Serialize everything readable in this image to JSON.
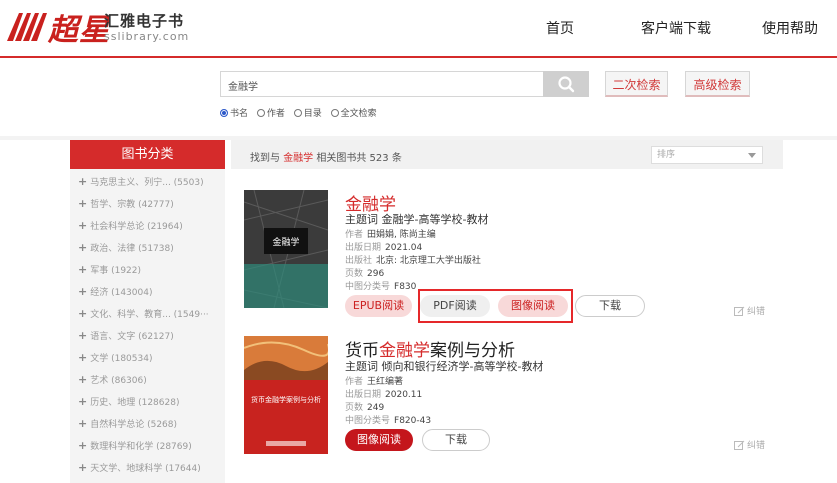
{
  "header": {
    "logo_cn": "超星",
    "title": "汇雅电子书",
    "subtitle": "sslibrary.com",
    "nav": [
      "首页",
      "客户端下载",
      "使用帮助"
    ]
  },
  "search": {
    "query": "金融学",
    "buttons": {
      "secondary": "二次检索",
      "advanced": "高级检索"
    },
    "scopes": [
      {
        "label": "书名",
        "selected": true
      },
      {
        "label": "作者",
        "selected": false
      },
      {
        "label": "目录",
        "selected": false
      },
      {
        "label": "全文检索",
        "selected": false
      }
    ]
  },
  "sidebar": {
    "heading": "图书分类",
    "categories": [
      "马克思主义、列宁... (5503)",
      "哲学、宗教 (42777)",
      "社会科学总论 (21964)",
      "政治、法律 (51738)",
      "军事 (1922)",
      "经济 (143004)",
      "文化、科学、教育... (1549···",
      "语言、文字 (62127)",
      "文学 (180534)",
      "艺术 (86306)",
      "历史、地理 (128628)",
      "自然科学总论 (5268)",
      "数理科学和化学 (28769)",
      "天文学、地球科学 (17644)"
    ]
  },
  "results": {
    "found_prefix": "找到与",
    "found_keyword": "金融学",
    "found_suffix": "相关图书共 523 条",
    "sort_placeholder": "排序",
    "correct_label": "纠错",
    "books": [
      {
        "title_hl": "金融学",
        "title_rest": "",
        "cover_title": "金融学",
        "subject_label": "主题词",
        "subject": "金融学-高等学校-教材",
        "author_label": "作者",
        "author": "田娟娟, 陈尚主编",
        "date_label": "出版日期",
        "date": "2021.04",
        "publisher_label": "出版社",
        "publisher": "北京: 北京理工大学出版社",
        "pages_label": "页数",
        "pages": "296",
        "clc_label": "中图分类号",
        "clc": "F830",
        "actions": [
          "EPUB阅读",
          "PDF阅读",
          "图像阅读",
          "下载"
        ]
      },
      {
        "title_pre": "货币",
        "title_hl": "金融学",
        "title_rest": "案例与分析",
        "cover_title": "货币金融学案例与分析",
        "subject_label": "主题词",
        "subject": "倾向和银行经济学-高等学校-教材",
        "author_label": "作者",
        "author": "王红编著",
        "date_label": "出版日期",
        "date": "2020.11",
        "pages_label": "页数",
        "pages": "249",
        "clc_label": "中图分类号",
        "clc": "F820-43",
        "actions": [
          "图像阅读",
          "下载"
        ]
      }
    ]
  },
  "colors": {
    "brand_red": "#d52b2b",
    "highlight_red": "#e5282a",
    "button_red": "#c4161c"
  }
}
